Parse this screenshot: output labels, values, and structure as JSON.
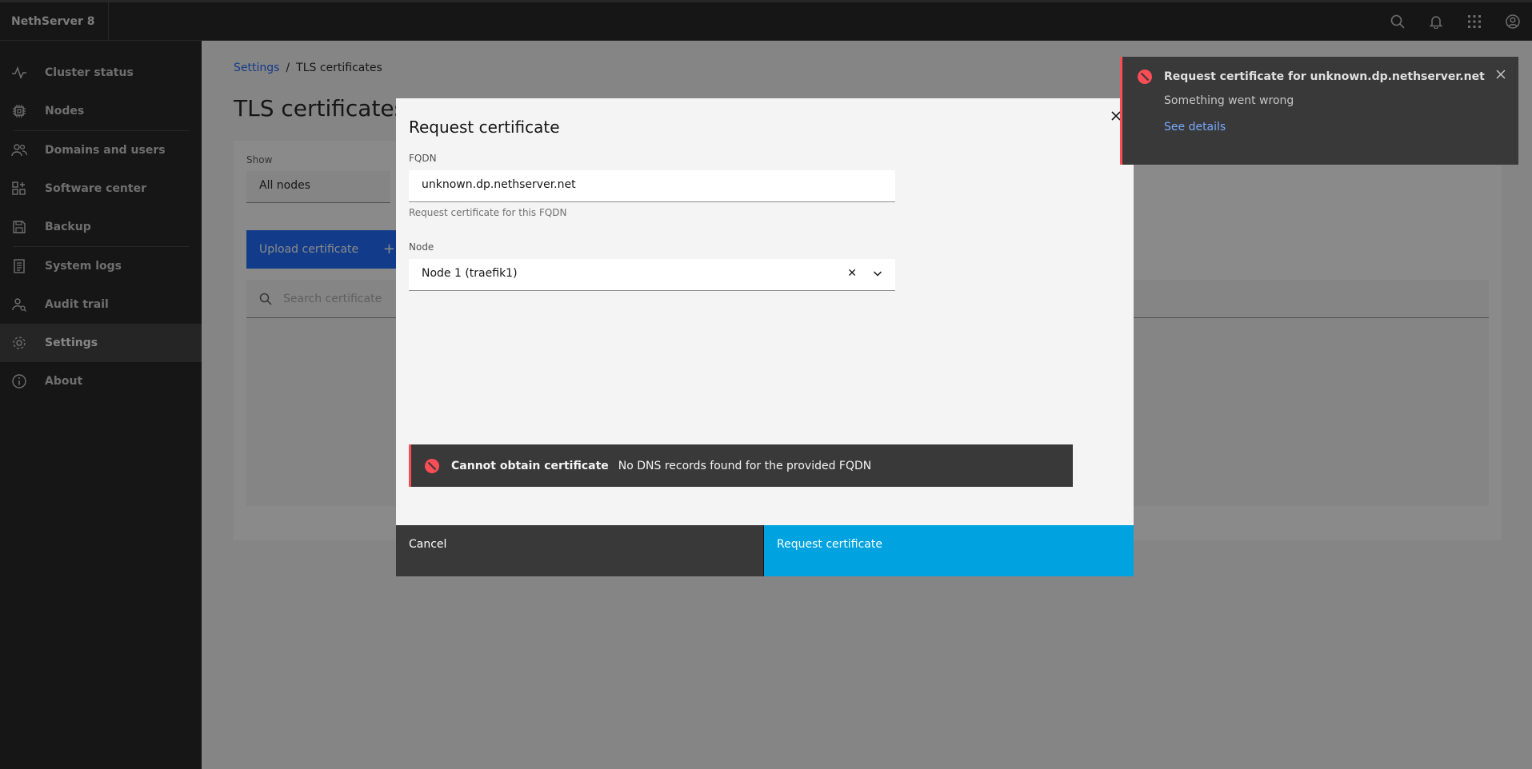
{
  "app": {
    "title": "NethServer 8"
  },
  "header": {
    "icons": [
      "search-icon",
      "notification-icon",
      "app-switcher-icon",
      "user-avatar-icon"
    ]
  },
  "sidebar": {
    "items": [
      {
        "label": "Cluster status",
        "icon": "activity-icon"
      },
      {
        "label": "Nodes",
        "icon": "chip-icon"
      },
      {
        "label": "Domains and users",
        "icon": "user-group-icon"
      },
      {
        "label": "Software center",
        "icon": "apps-icon"
      },
      {
        "label": "Backup",
        "icon": "save-icon"
      },
      {
        "label": "System logs",
        "icon": "log-icon"
      },
      {
        "label": "Audit trail",
        "icon": "audit-icon"
      },
      {
        "label": "Settings",
        "icon": "gear-icon",
        "active": true
      },
      {
        "label": "About",
        "icon": "info-icon"
      }
    ]
  },
  "main": {
    "breadcrumb": {
      "parent": "Settings",
      "separator": "/",
      "current": "TLS certificates"
    },
    "title": "TLS certificates",
    "show": {
      "label": "Show",
      "value": "All nodes"
    },
    "upload_button": "Upload certificate",
    "search": {
      "placeholder": "Search certificate"
    }
  },
  "modal": {
    "title": "Request certificate",
    "fqdn": {
      "label": "FQDN",
      "value": "unknown.dp.nethserver.net",
      "helper": "Request certificate for this FQDN"
    },
    "node": {
      "label": "Node",
      "value": "Node 1 (traefik1)"
    },
    "error": {
      "title": "Cannot obtain certificate",
      "message": "No DNS records found for the provided FQDN"
    },
    "cancel_label": "Cancel",
    "submit_label": "Request certificate"
  },
  "toast": {
    "title": "Request certificate for unknown.dp.nethserver.net",
    "subtitle": "Something went wrong",
    "link": "See details"
  },
  "colors": {
    "primary": "#00a3e0",
    "error": "#fa4d56",
    "sidebar_bg": "#161616"
  }
}
